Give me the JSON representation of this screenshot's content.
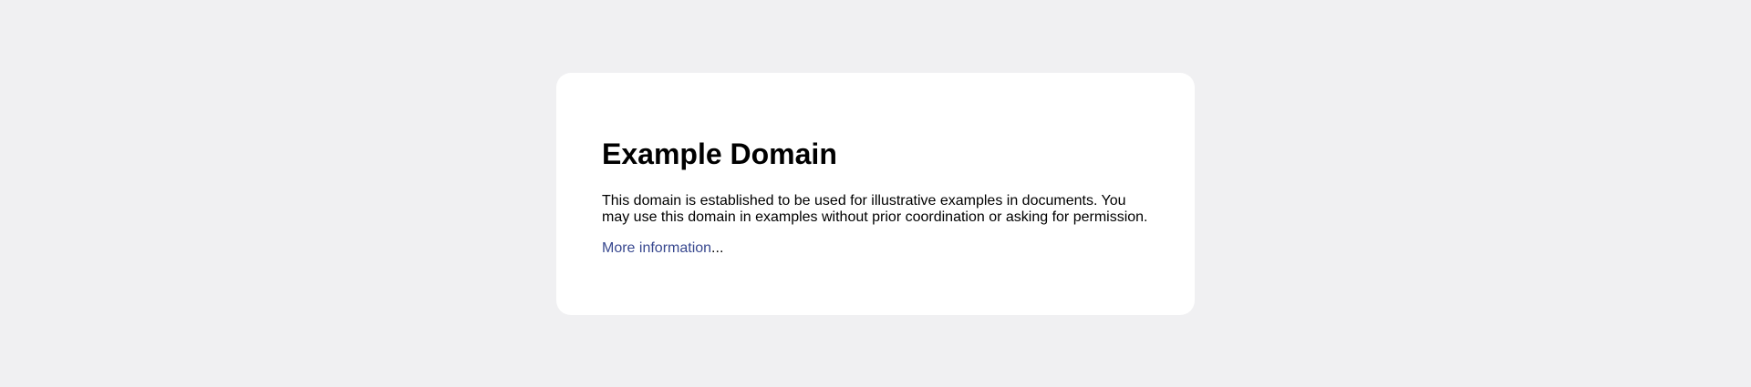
{
  "page": {
    "title": "Example Domain",
    "description": "This domain is established to be used for illustrative examples in documents. You may use this domain in examples without prior coordination or asking for permission.",
    "link_text": "More information",
    "link_suffix": "..."
  },
  "colors": {
    "background": "#f0f0f2",
    "card": "#ffffff",
    "text": "#000000",
    "link": "#38488f"
  }
}
